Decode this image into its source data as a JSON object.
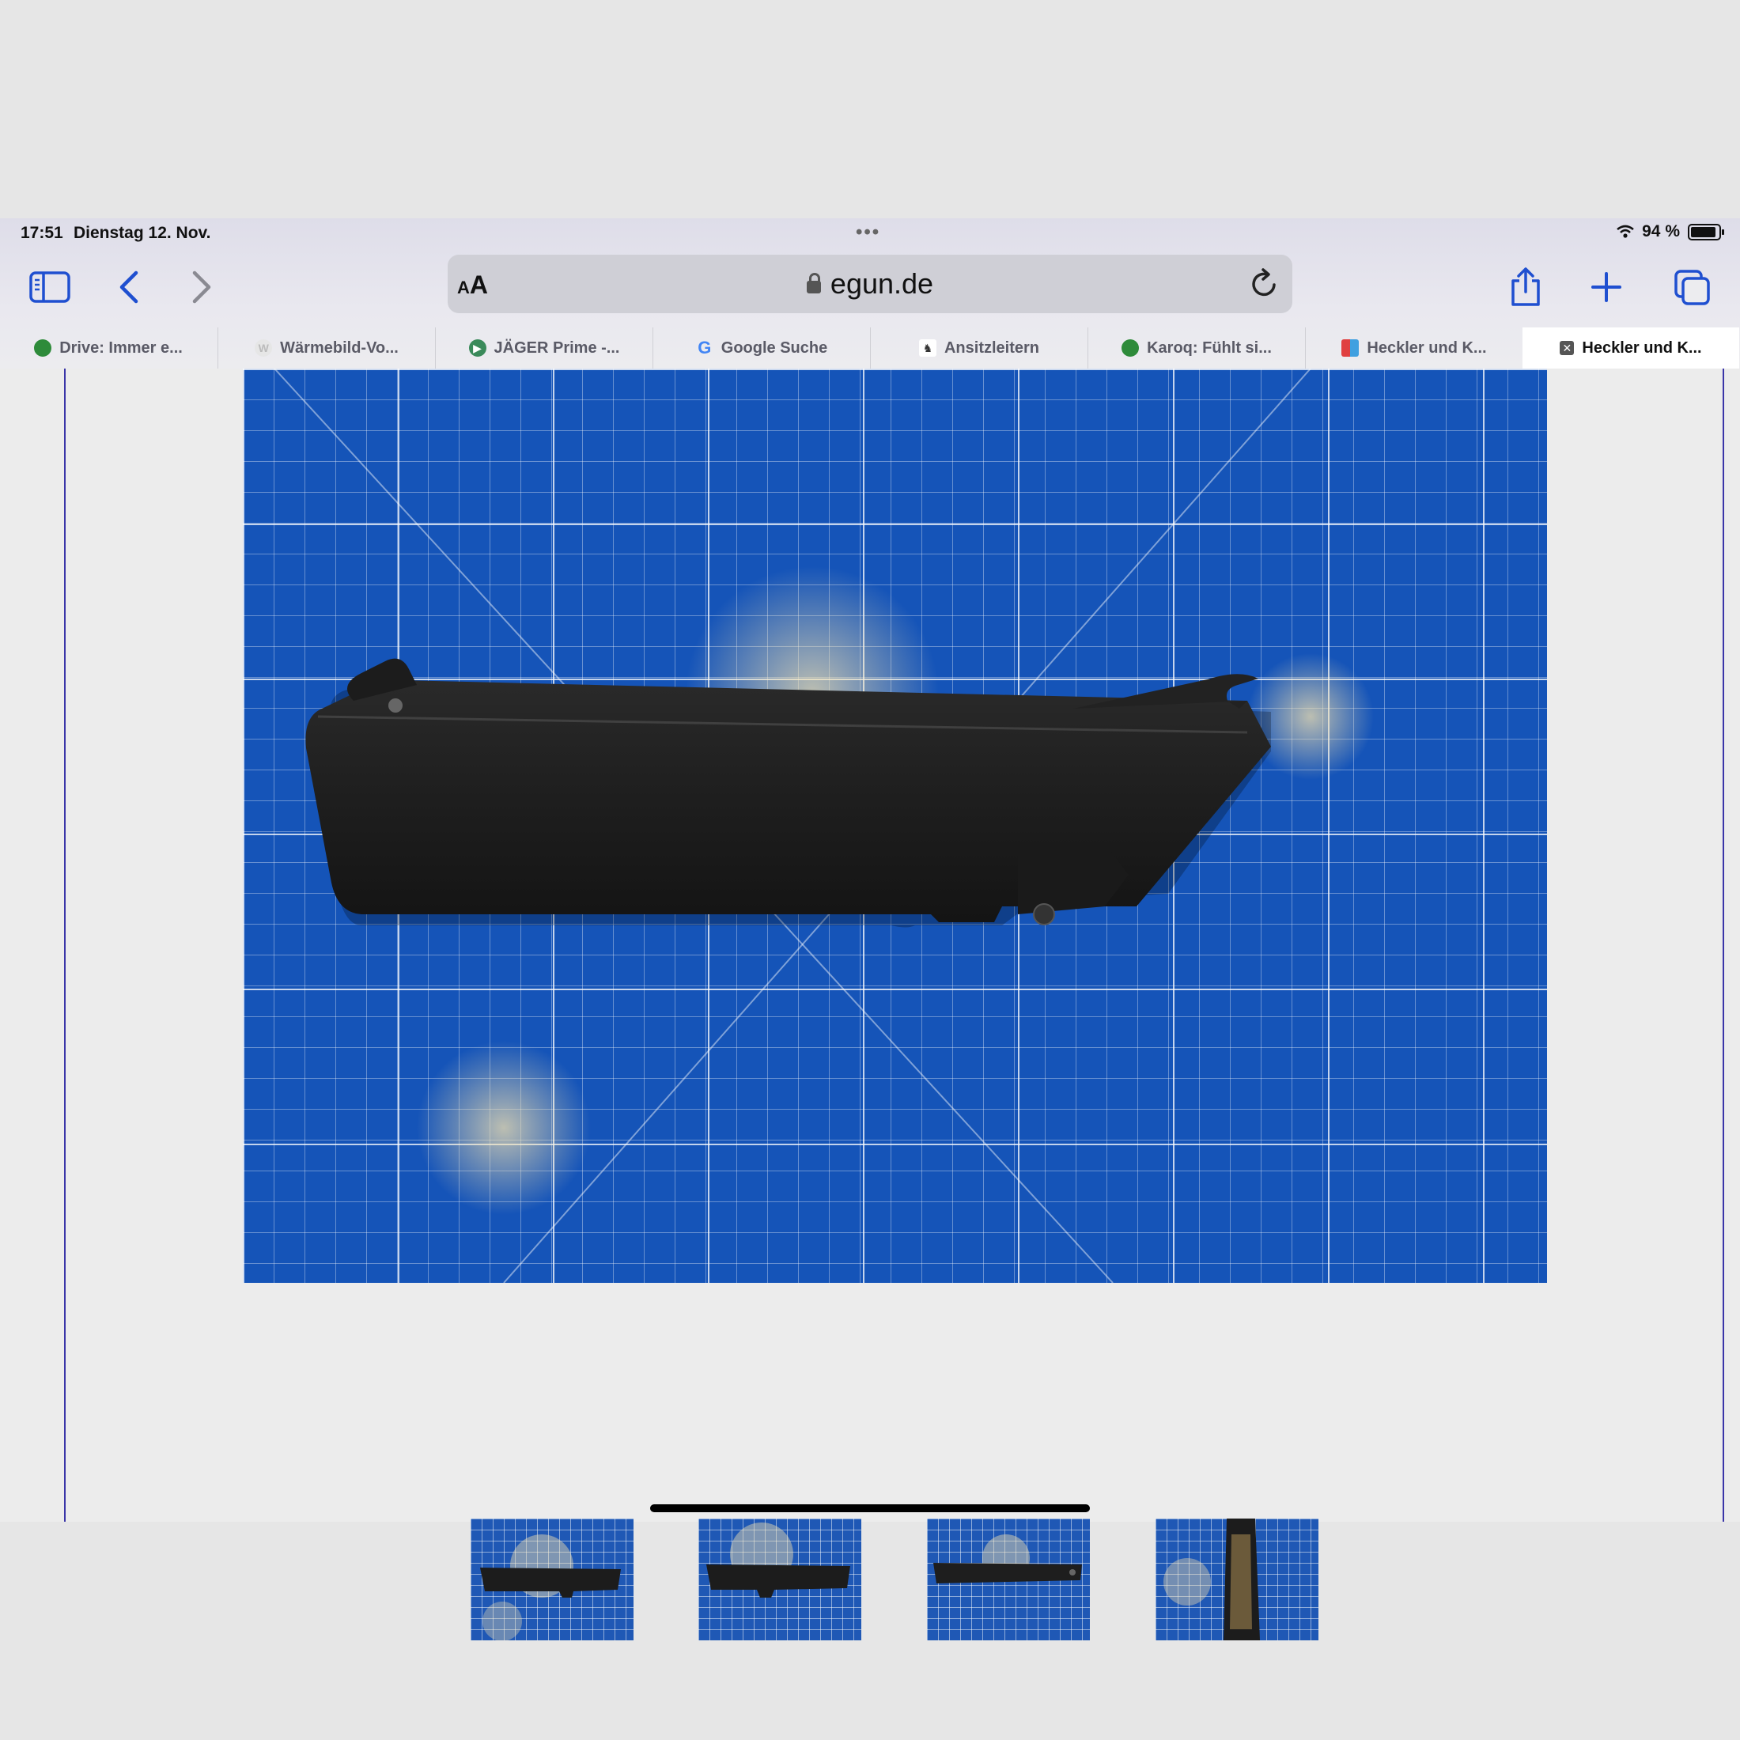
{
  "status_bar": {
    "time": "17:51",
    "date": "Dienstag 12. Nov.",
    "battery": "94 %"
  },
  "toolbar": {
    "aa_label_small": "A",
    "aa_label_large": "A",
    "url": "egun.de"
  },
  "tabs": [
    {
      "label": "Drive: Immer e...",
      "icon": "skoda-icon",
      "color": "#2e8b3a"
    },
    {
      "label": "Wärmebild-Vo...",
      "icon": "w-icon",
      "color": "#cccccc"
    },
    {
      "label": "JÄGER Prime -...",
      "icon": "play-icon",
      "color": "#3a8a5a"
    },
    {
      "label": "Google Suche",
      "icon": "google-icon",
      "color": "#4285f4"
    },
    {
      "label": "Ansitzleitern",
      "icon": "hunter-icon",
      "color": "#333333"
    },
    {
      "label": "Karoq: Fühlt si...",
      "icon": "skoda-icon",
      "color": "#2e8b3a"
    },
    {
      "label": "Heckler und K...",
      "icon": "egun-icon",
      "color": "#e04040"
    },
    {
      "label": "Heckler und K...",
      "icon": "close-icon",
      "color": "#555555"
    }
  ],
  "colors": {
    "accent": "#1f4fd0",
    "mat_blue": "#1554b8",
    "page_border": "#3a35a8"
  },
  "gallery": {
    "thumbnail_count": 4,
    "selected_image": 1
  }
}
